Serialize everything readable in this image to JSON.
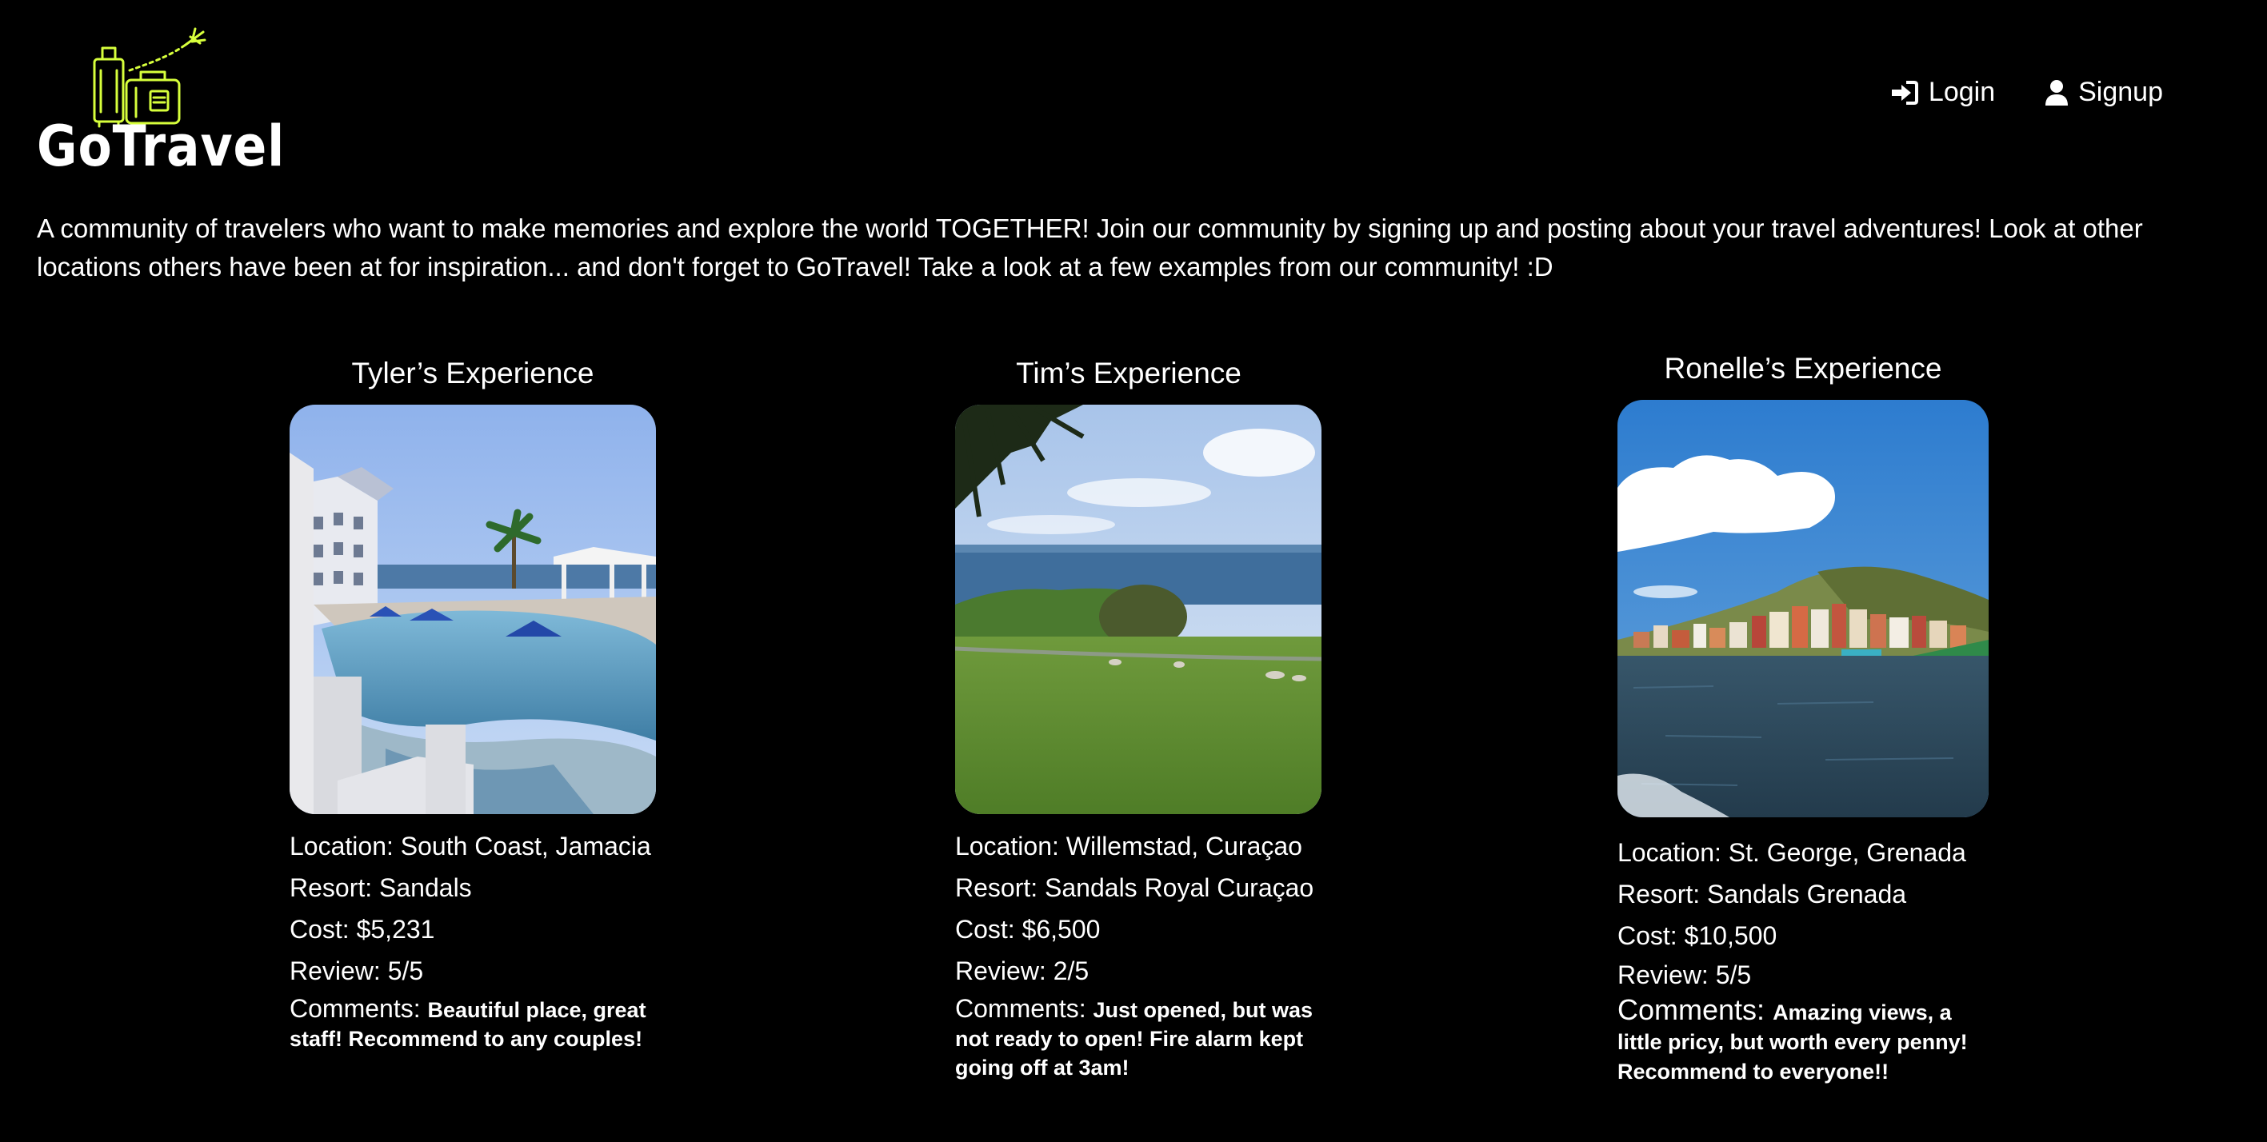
{
  "app": {
    "brand": "GoTravel"
  },
  "nav": {
    "login": "Login",
    "signup": "Signup"
  },
  "intro": "A community of travelers who want to make memories and explore the world TOGETHER! Join our community by signing up and posting about your travel adventures! Look at other locations others have been at for inspiration... and don't forget to GoTravel! Take a look at a few examples from our community! :D",
  "cards": [
    {
      "title": "Tyler’s Experience",
      "location": "Location: South Coast, Jamacia",
      "resort": "Resort: Sandals",
      "cost": "Cost: $5,231",
      "review": "Review: 5/5",
      "comments_label": "Comments:",
      "comments": "Beautiful place, great staff! Recommend to any couples!"
    },
    {
      "title": "Tim’s Experience",
      "location": "Location: Willemstad, Curaçao",
      "resort": "Resort: Sandals Royal Curaçao",
      "cost": "Cost: $6,500",
      "review": "Review: 2/5",
      "comments_label": "Comments:",
      "comments": "Just opened, but was not ready to open! Fire alarm kept going off at 3am!"
    },
    {
      "title": "Ronelle’s Experience",
      "location": "Location: St. George, Grenada",
      "resort": "Resort: Sandals Grenada",
      "cost": "Cost: $10,500",
      "review": "Review: 5/5",
      "comments_label": "Comments:",
      "comments": "Amazing views, a little pricy, but worth every penny! Recommend to everyone!!"
    }
  ],
  "colors": {
    "background": "#000000",
    "text": "#ffffff",
    "logo_accent": "#d7ff3c"
  },
  "icons": {
    "logo": "luggage-plane-icon",
    "login": "sign-in-icon",
    "signup": "user-icon"
  }
}
